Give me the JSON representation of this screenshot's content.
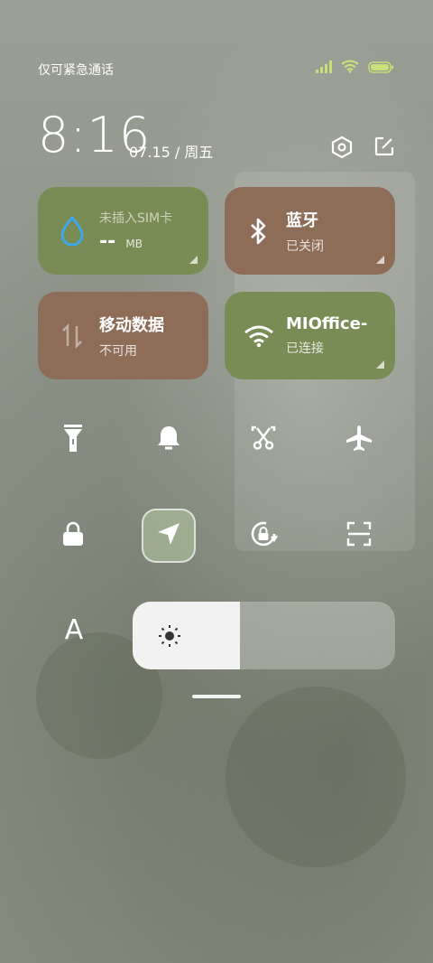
{
  "status_bar": {
    "carrier_text": "仅可紧急通话",
    "icons": [
      "signal-icon",
      "wifi-icon",
      "battery-icon"
    ]
  },
  "header": {
    "time": "8:16",
    "date": "07.15 / 周五",
    "icons": [
      "settings-icon",
      "edit-icon"
    ]
  },
  "tiles": [
    {
      "name": "mobile-data-usage",
      "title": "未插入SIM卡",
      "value": "--",
      "unit": "MB",
      "color": "#7a8c55",
      "icon": "water-drop-icon"
    },
    {
      "name": "bluetooth",
      "title": "蓝牙",
      "subtitle": "已关闭",
      "color": "#8d6c58",
      "icon": "bluetooth-icon"
    },
    {
      "name": "mobile-data",
      "title": "移动数据",
      "subtitle": "不可用",
      "color": "#8d6c58",
      "icon": "data-arrows-icon"
    },
    {
      "name": "wifi",
      "title": "MIOffice-",
      "subtitle": "已连接",
      "color": "#7a8c55",
      "icon": "wifi-icon"
    }
  ],
  "toggles": [
    {
      "name": "flashlight",
      "icon": "flashlight-icon",
      "active": false
    },
    {
      "name": "ringer",
      "icon": "bell-icon",
      "active": false
    },
    {
      "name": "screenshot",
      "icon": "scissors-icon",
      "active": false
    },
    {
      "name": "airplane-mode",
      "icon": "airplane-icon",
      "active": false
    },
    {
      "name": "lock-screen",
      "icon": "lock-icon",
      "active": false
    },
    {
      "name": "location",
      "icon": "location-arrow-icon",
      "active": true
    },
    {
      "name": "rotation-lock",
      "icon": "rotation-lock-icon",
      "active": false
    },
    {
      "name": "scanner",
      "icon": "scan-icon",
      "active": false
    }
  ],
  "font_button_label": "A",
  "brightness": {
    "level": 0.41,
    "icon": "sun-icon"
  },
  "colors": {
    "green_tile": "#7a8c55",
    "brown_tile": "#8d6c58",
    "active_toggle": "#b4c8a0"
  }
}
